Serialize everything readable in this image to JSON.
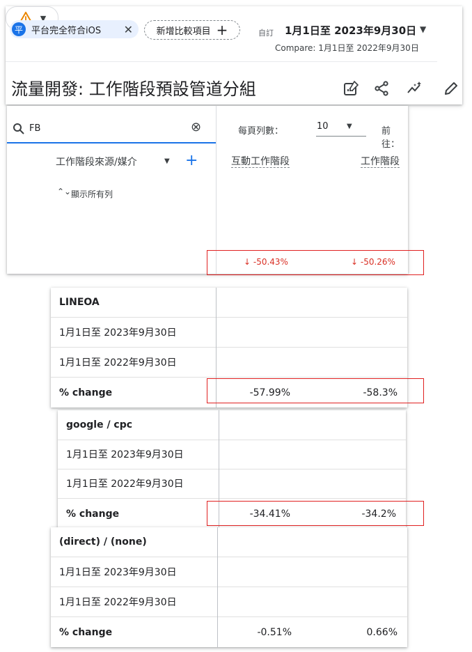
{
  "header": {
    "segment_chip": {
      "avatar": "平",
      "label": "平台完全符合iOS",
      "close_icon": "close-icon"
    },
    "add_compare_chip": {
      "label": "新增比較項目",
      "icon": "plus-icon"
    },
    "date": {
      "custom_label": "自訂",
      "range": "1月1日至 2023年9月30日",
      "compare": "Compare: 1月1日至 2022年9月30日"
    },
    "title": "流量開發: 工作階段預設管道分組",
    "toolbar_icons": [
      "warning-icon",
      "edit-report-icon",
      "share-icon",
      "insights-icon",
      "pencil-icon"
    ]
  },
  "table": {
    "search": {
      "value": "FB"
    },
    "pagination": {
      "rows_per_page_label": "每頁列數：",
      "rows_per_page_value": "10",
      "goto_label": "前往："
    },
    "dimension_header": "工作階段來源/媒介",
    "show_all_rows": "顯示所有列",
    "metric_headers": [
      "互動工作階段",
      "工作階段"
    ],
    "summary_change": [
      "↓ -50.43%",
      "↓ -50.26%"
    ]
  },
  "groups": [
    {
      "name": "LINEOA",
      "rows": [
        "1月1日至 2023年9月30日",
        "1月1日至 2022年9月30日"
      ],
      "change_label": "% change",
      "change_values": [
        "-57.99%",
        "-58.3%"
      ]
    },
    {
      "name": "google / cpc",
      "rows": [
        "1月1日至 2023年9月30日",
        "1月1日至 2022年9月30日"
      ],
      "change_label": "% change",
      "change_values": [
        "-34.41%",
        "-34.2%"
      ]
    },
    {
      "name": "(direct) / (none)",
      "rows": [
        "1月1日至 2023年9月30日",
        "1月1日至 2022年9月30日"
      ],
      "change_label": "% change",
      "change_values": [
        "-0.51%",
        "0.66%"
      ]
    }
  ],
  "colors": {
    "accent": "#1a73e8",
    "negative": "#d93025",
    "highlight_box": "#e02020",
    "warning": "#ea8600"
  }
}
